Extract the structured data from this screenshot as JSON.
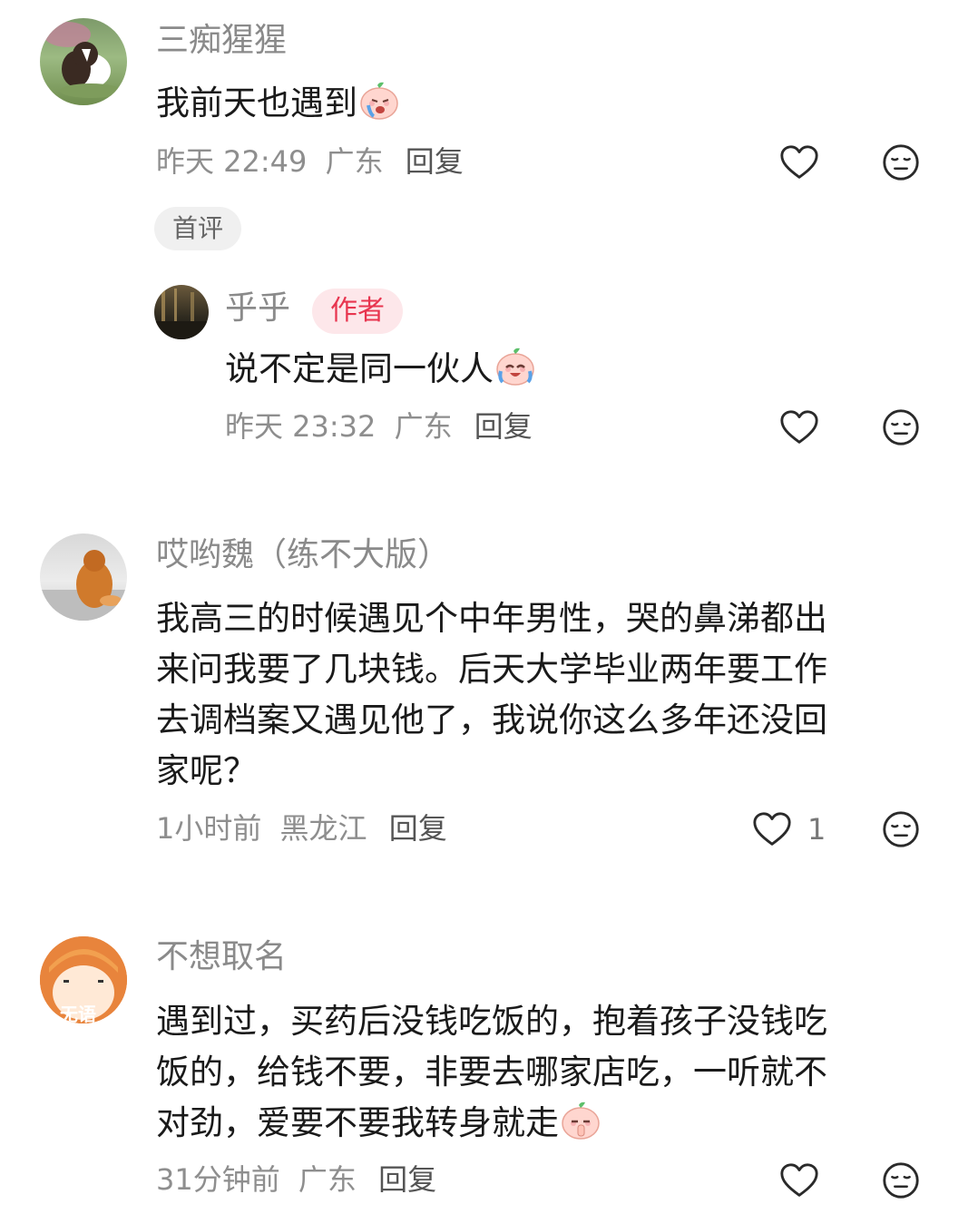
{
  "comments": [
    {
      "user": "三痴猩猩",
      "text": "我前天也遇到",
      "emoji": "crying-face-emoji",
      "time": "昨天 22:49",
      "location": "广东",
      "reply_label": "回复",
      "badge": "首评",
      "likes": ""
    },
    {
      "user": "乎乎",
      "author_badge": "作者",
      "text": "说不定是同一伙人",
      "emoji": "laugh-cry-emoji",
      "time": "昨天 23:32",
      "location": "广东",
      "reply_label": "回复",
      "likes": ""
    },
    {
      "user": "哎哟魏（练不大版）",
      "text_lines": [
        "我高三的时候遇见个中年男性，哭的鼻涕都出",
        "来问我要了几块钱。后天大学毕业两年要工作",
        "去调档案又遇见他了，我说你这么多年还没回",
        "家呢？"
      ],
      "time": "1小时前",
      "location": "黑龙江",
      "reply_label": "回复",
      "likes": "1"
    },
    {
      "user": "不想取名",
      "avatar_text": "无语",
      "text_lines": [
        "遇到过，买药后没钱吃饭的，抱着孩子没钱吃",
        "饭的，给钱不要，非要去哪家店吃，一听就不",
        "对劲，爱要不要我转身就走"
      ],
      "emoji": "shush-emoji",
      "time": "31分钟前",
      "location": "广东",
      "reply_label": "回复",
      "likes": ""
    }
  ],
  "colors": {
    "accent_red": "#e8354f",
    "muted": "#8e8e8e"
  }
}
